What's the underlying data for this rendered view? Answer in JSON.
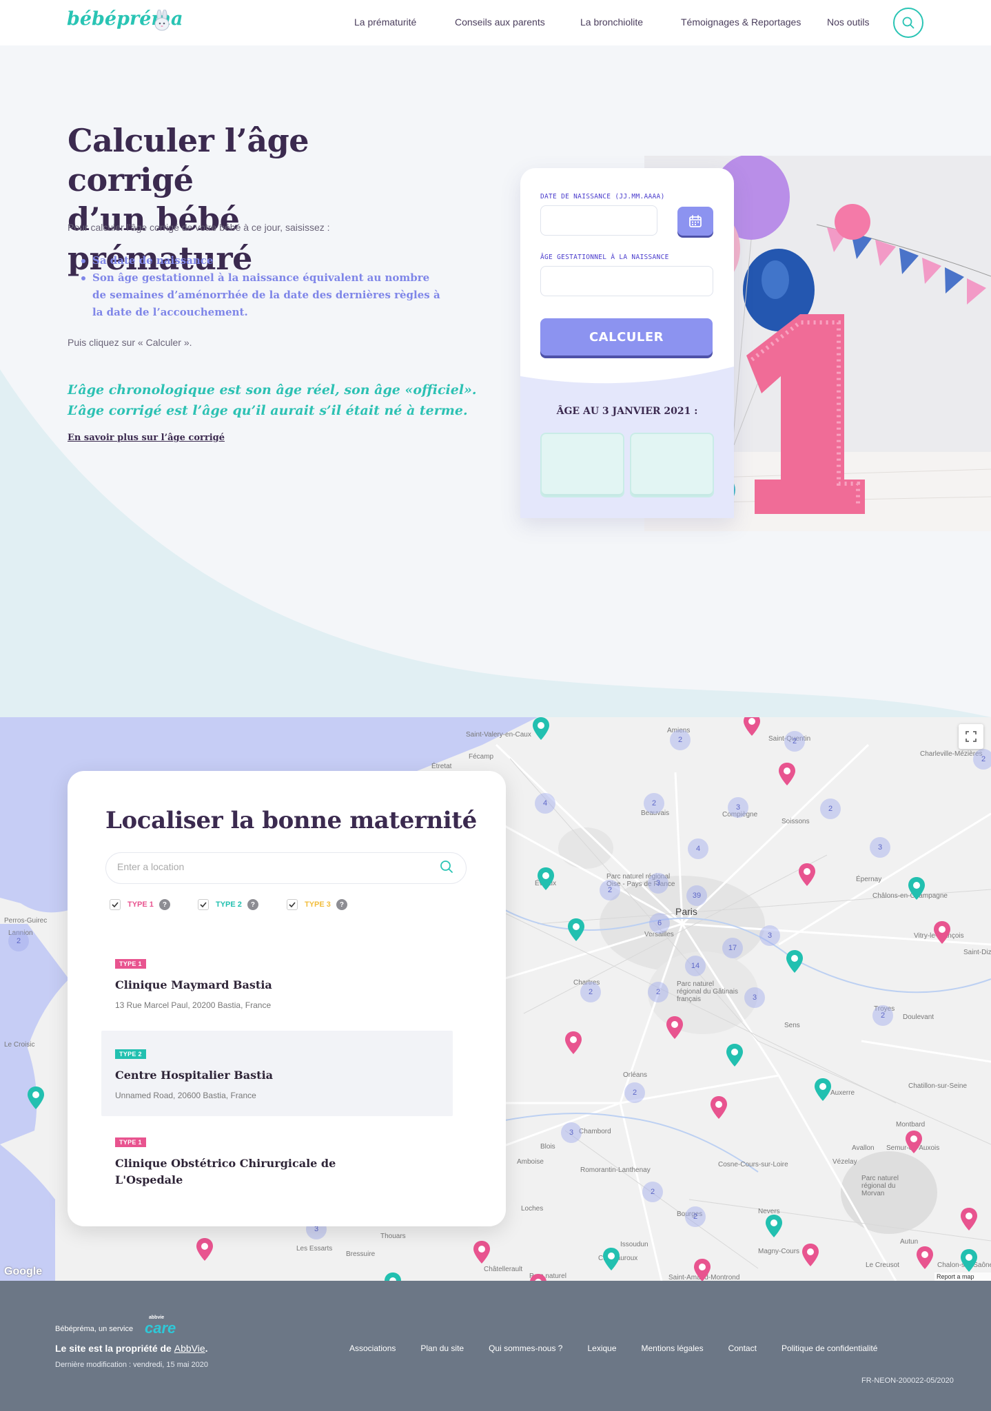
{
  "header": {
    "logo": "bébépréma",
    "nav": [
      "La prématurité",
      "Conseils aux parents",
      "La bronchiolite",
      "Témoignages & Reportages",
      "Nos outils"
    ]
  },
  "hero": {
    "title_line1": "Calculer l’âge corrigé",
    "title_line2": "d’un bébé prématuré",
    "intro": "Pour calculer l’âge corrigé de votre bébé à ce jour, saisissez :",
    "bullets": [
      "Sa date de naissance",
      "Son âge gestationnel à la naissance équivalent au nombre de semaines d’aménorrhée de la date des dernières règles à la date de l’accouchement."
    ],
    "then": "Puis cliquez sur « Calculer ».",
    "quote_line1": "L’âge chronologique est son âge réel, son âge «officiel».",
    "quote_line2": "L’âge corrigé est l’âge qu’il aurait s’il était né à terme.",
    "link": "En savoir plus sur l’âge corrigé"
  },
  "calculator": {
    "birth_label": "DATE DE NAISSANCE (JJ.MM.AAAA)",
    "birth_value": "",
    "gest_label": "ÂGE GESTATIONNEL À LA NAISSANCE",
    "gest_value": "",
    "button": "CALCULER",
    "age_label": "ÂGE AU 3 JANVIER 2021 :",
    "colors": {
      "accent": "#8c93f0",
      "accent_dark": "#4d51a8"
    }
  },
  "locator": {
    "title": "Localiser la bonne maternité",
    "search_placeholder": "Enter a location",
    "filters": [
      {
        "label": "TYPE 1",
        "checked": true,
        "color": "#e8548f"
      },
      {
        "label": "TYPE 2",
        "checked": true,
        "color": "#22c0b0"
      },
      {
        "label": "TYPE 3",
        "checked": true,
        "color": "#f2bd3c"
      }
    ],
    "help_icon": "?",
    "results": [
      {
        "type": "TYPE 1",
        "type_color": "#e8548f",
        "name": "Clinique Maymard Bastia",
        "address": "13 Rue Marcel Paul, 20200 Bastia, France"
      },
      {
        "type": "TYPE 2",
        "type_color": "#22c0b0",
        "name": "Centre Hospitalier Bastia",
        "address": "Unnamed Road, 20600 Bastia, France"
      },
      {
        "type": "TYPE 1",
        "type_color": "#e8548f",
        "name_line1": "Clinique Obstétrico Chirurgicale de",
        "name_line2": "L'Ospedale",
        "address": ""
      }
    ]
  },
  "map": {
    "attribution": "Google",
    "report": "Report a map error",
    "places": [
      "Saint-Valery-en-Caux",
      "Fécamp",
      "Étretat",
      "Amiens",
      "Saint-Quentin",
      "Charleville-Mézières",
      "Soissons",
      "Compiègne",
      "Beauvais",
      "Évreux",
      "Parc naturel régional Oise - Pays de France",
      "Paris",
      "Versailles",
      "Épernay",
      "Châlons-en-Champagne",
      "Vitry-le-François",
      "Saint-Dizier",
      "Chartres",
      "Parc naturel régional du Gâtinais français",
      "Sens",
      "Troyes",
      "Orléans",
      "Auxerre",
      "Chambord",
      "Blois",
      "Amboise",
      "Romorantin-Lanthenay",
      "Bourges",
      "Nevers",
      "Montbard",
      "Avallon",
      "Parc naturel régional du Morvan",
      "Autun",
      "Le Creusot",
      "Chalon-sur-Saône",
      "Châtellerault",
      "Bressuire",
      "Les Essarts",
      "Thouars",
      "Perros-Guirec",
      "Lannion",
      "Le Croisic",
      "Cosne-Cours-sur-Loire",
      "Vézelay",
      "Issoudun",
      "Saint-Amand-Montrond",
      "Châteauroux",
      "Loches",
      "Doulevant",
      "Chatillon-sur-Seine",
      "Semur-en-Auxois",
      "Magny-Cours",
      "Parc naturel"
    ],
    "clusters": [
      "2",
      "2",
      "2",
      "4",
      "2",
      "3",
      "4",
      "3",
      "2",
      "39",
      "6",
      "17",
      "3",
      "3",
      "14",
      "2",
      "2",
      "3",
      "2",
      "2",
      "2",
      "3",
      "2",
      "2",
      "3",
      "2"
    ]
  },
  "footer": {
    "service": "Bébépréma, un service",
    "care_small": "abbvie",
    "care": "care",
    "owner_prefix": "Le site est la propriété de ",
    "owner_link": "AbbVie",
    "owner_suffix": ".",
    "modified": "Dernière modification : vendredi, 15 mai 2020",
    "links": [
      "Associations",
      "Plan du site",
      "Qui sommes-nous ?",
      "Lexique",
      "Mentions légales",
      "Contact",
      "Politique de confidentialité"
    ],
    "code": "FR-NEON-200022-05/2020"
  }
}
